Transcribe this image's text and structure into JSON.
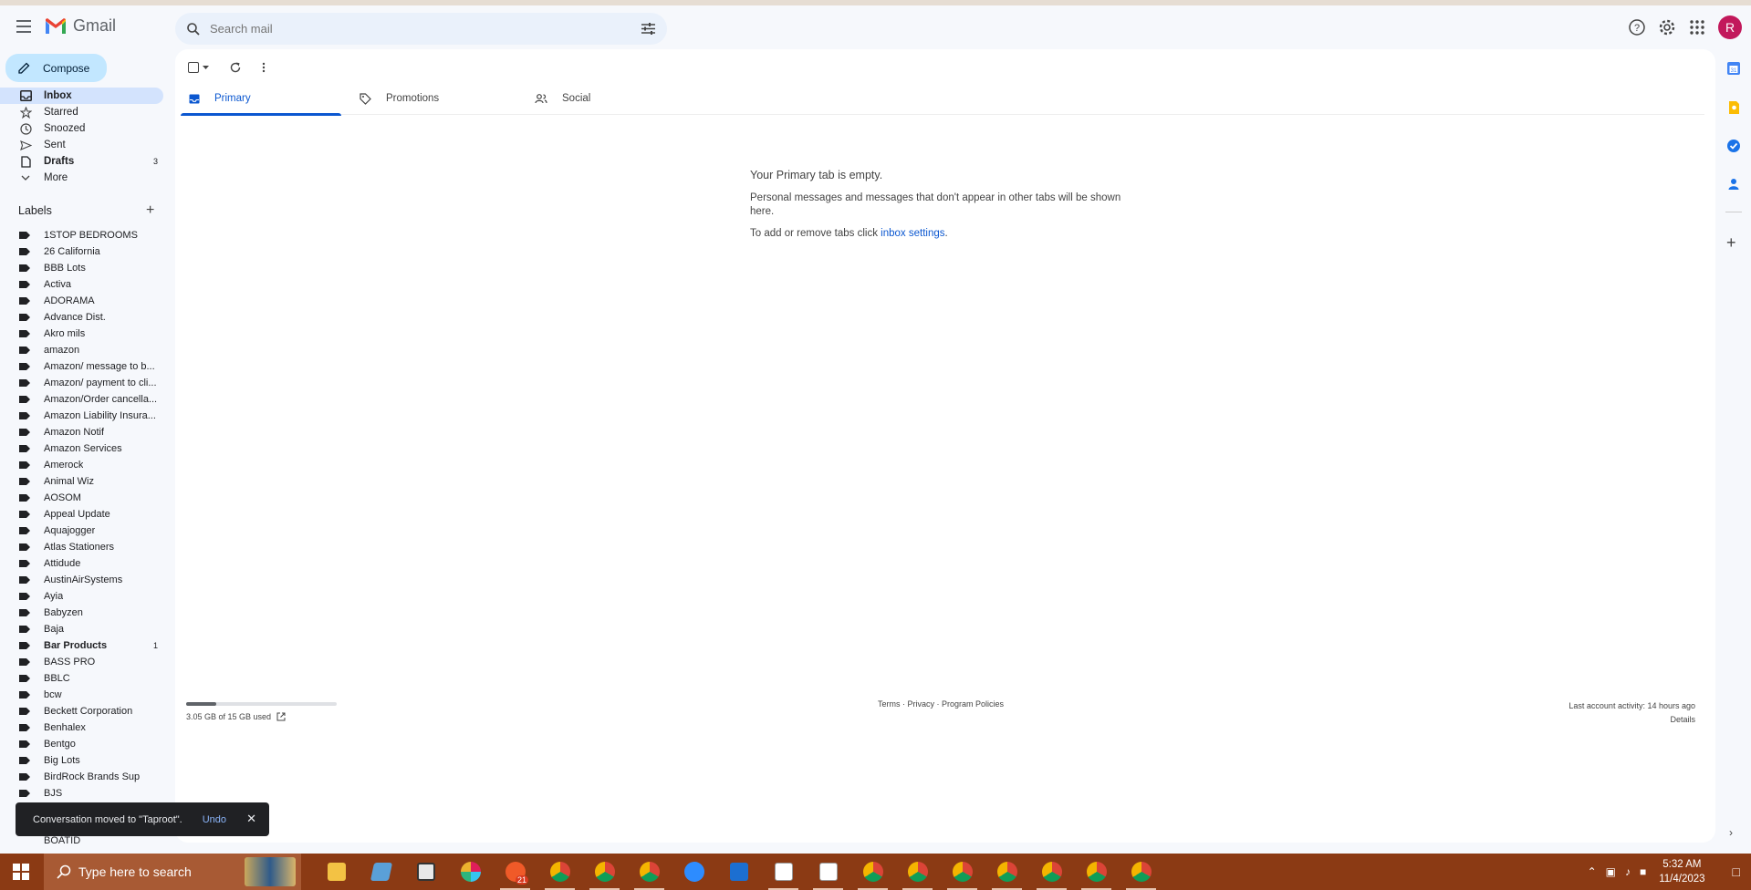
{
  "app": {
    "name": "Gmail"
  },
  "search": {
    "placeholder": "Search mail"
  },
  "avatar": {
    "initial": "R",
    "color": "#c2185b"
  },
  "compose": {
    "label": "Compose"
  },
  "nav": [
    {
      "label": "Inbox",
      "icon": "inbox-icon",
      "active": true,
      "count": ""
    },
    {
      "label": "Starred",
      "icon": "star-icon",
      "count": ""
    },
    {
      "label": "Snoozed",
      "icon": "clock-icon",
      "count": ""
    },
    {
      "label": "Sent",
      "icon": "send-icon",
      "count": ""
    },
    {
      "label": "Drafts",
      "icon": "draft-icon",
      "bold": true,
      "count": "3"
    },
    {
      "label": "More",
      "icon": "chevron-down-icon",
      "count": ""
    }
  ],
  "labels_header": "Labels",
  "labels": [
    {
      "name": "1STOP BEDROOMS"
    },
    {
      "name": "26 California"
    },
    {
      "name": "BBB Lots"
    },
    {
      "name": "Activa"
    },
    {
      "name": "ADORAMA"
    },
    {
      "name": "Advance Dist."
    },
    {
      "name": "Akro mils"
    },
    {
      "name": "amazon"
    },
    {
      "name": "Amazon/ message to b..."
    },
    {
      "name": "Amazon/ payment to cli..."
    },
    {
      "name": "Amazon/Order cancella..."
    },
    {
      "name": "Amazon Liability Insura..."
    },
    {
      "name": "Amazon Notif"
    },
    {
      "name": "Amazon Services"
    },
    {
      "name": "Amerock"
    },
    {
      "name": "Animal Wiz"
    },
    {
      "name": "AOSOM"
    },
    {
      "name": "Appeal Update"
    },
    {
      "name": "Aquajogger"
    },
    {
      "name": "Atlas Stationers"
    },
    {
      "name": "Attidude"
    },
    {
      "name": "AustinAirSystems"
    },
    {
      "name": "Ayia"
    },
    {
      "name": "Babyzen"
    },
    {
      "name": "Baja"
    },
    {
      "name": "Bar Products",
      "bold": true,
      "count": "1"
    },
    {
      "name": "BASS PRO"
    },
    {
      "name": "BBLC"
    },
    {
      "name": "bcw"
    },
    {
      "name": "Beckett Corporation"
    },
    {
      "name": "Benhalex"
    },
    {
      "name": "Bentgo"
    },
    {
      "name": "Big Lots"
    },
    {
      "name": "BirdRock Brands Sup"
    },
    {
      "name": "BJS"
    }
  ],
  "last_label": "BOATID",
  "tabs": [
    {
      "label": "Primary",
      "active": true
    },
    {
      "label": "Promotions"
    },
    {
      "label": "Social"
    }
  ],
  "empty_state": {
    "title": "Your Primary tab is empty.",
    "body": "Personal messages and messages that don't appear in other tabs will be shown here.",
    "settings_prefix": "To add or remove tabs click ",
    "settings_link": "inbox settings",
    "settings_suffix": "."
  },
  "footer": {
    "storage": "3.05 GB of 15 GB used",
    "storage_fraction": 0.2,
    "links": "Terms · Privacy · Program Policies",
    "activity": "Last account activity: 14 hours ago",
    "details": "Details"
  },
  "toast": {
    "message": "Conversation moved to \"Taproot\".",
    "action": "Undo"
  },
  "taskbar": {
    "search_placeholder": "Type here to search",
    "time": "5:32 AM",
    "date": "11/4/2023",
    "badge": "21"
  }
}
